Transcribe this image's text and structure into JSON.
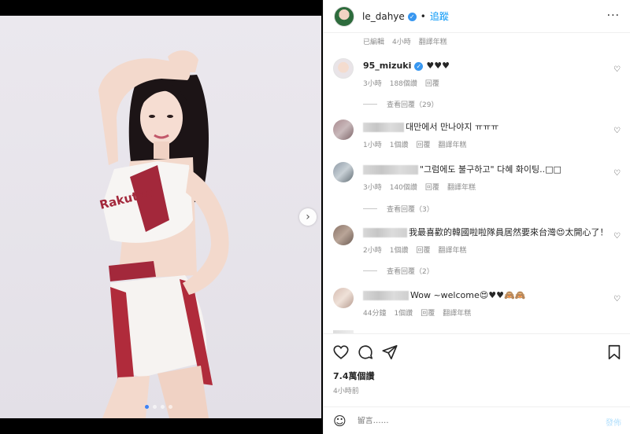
{
  "header": {
    "username": "le_dahye",
    "follow_label": "追蹤",
    "separator": "•",
    "more_label": "···"
  },
  "caption_meta": {
    "edited": "已編輯",
    "time": "4小時",
    "translate": "翻譯年糕"
  },
  "comments": [
    {
      "username": "95_mizuki",
      "verified": true,
      "text": "♥♥♥",
      "time": "3小時",
      "likes": "188個讚",
      "reply": "回覆",
      "translate": "",
      "view_replies": "查看回覆（29）"
    },
    {
      "username": "",
      "text": "대만에서 만나야지 ㅠㅠㅠ",
      "time": "1小時",
      "likes": "1個讚",
      "reply": "回覆",
      "translate": "翻譯年糕",
      "view_replies": ""
    },
    {
      "username": "",
      "text": "\"그럼에도 불구하고\" 다혜 화이팅..□□",
      "time": "3小時",
      "likes": "140個讚",
      "reply": "回覆",
      "translate": "翻譯年糕",
      "view_replies": "查看回覆（3）"
    },
    {
      "username": "",
      "text": "我最喜歡的韓國啦啦隊員居然要來台灣😍太開心了！",
      "time": "2小時",
      "likes": "1個讚",
      "reply": "回覆",
      "translate": "翻譯年糕",
      "view_replies": "查看回覆（2）"
    },
    {
      "username": "",
      "text": "Wow ~welcome😍♥♥🙈🙈",
      "time": "44分鐘",
      "likes": "1個讚",
      "reply": "回覆",
      "translate": "翻譯年糕",
      "view_replies": ""
    }
  ],
  "actions": {
    "likes": "7.4萬個讚",
    "time": "4小時前"
  },
  "composer": {
    "placeholder": "留言……",
    "post_label": "發佈"
  },
  "media": {
    "next_label": "›",
    "page_count": 4,
    "current_page": 1
  },
  "colors": {
    "link_blue": "#0095f6",
    "verified_blue": "#3897f0",
    "muted": "#8e8e8e",
    "text": "#262626"
  }
}
